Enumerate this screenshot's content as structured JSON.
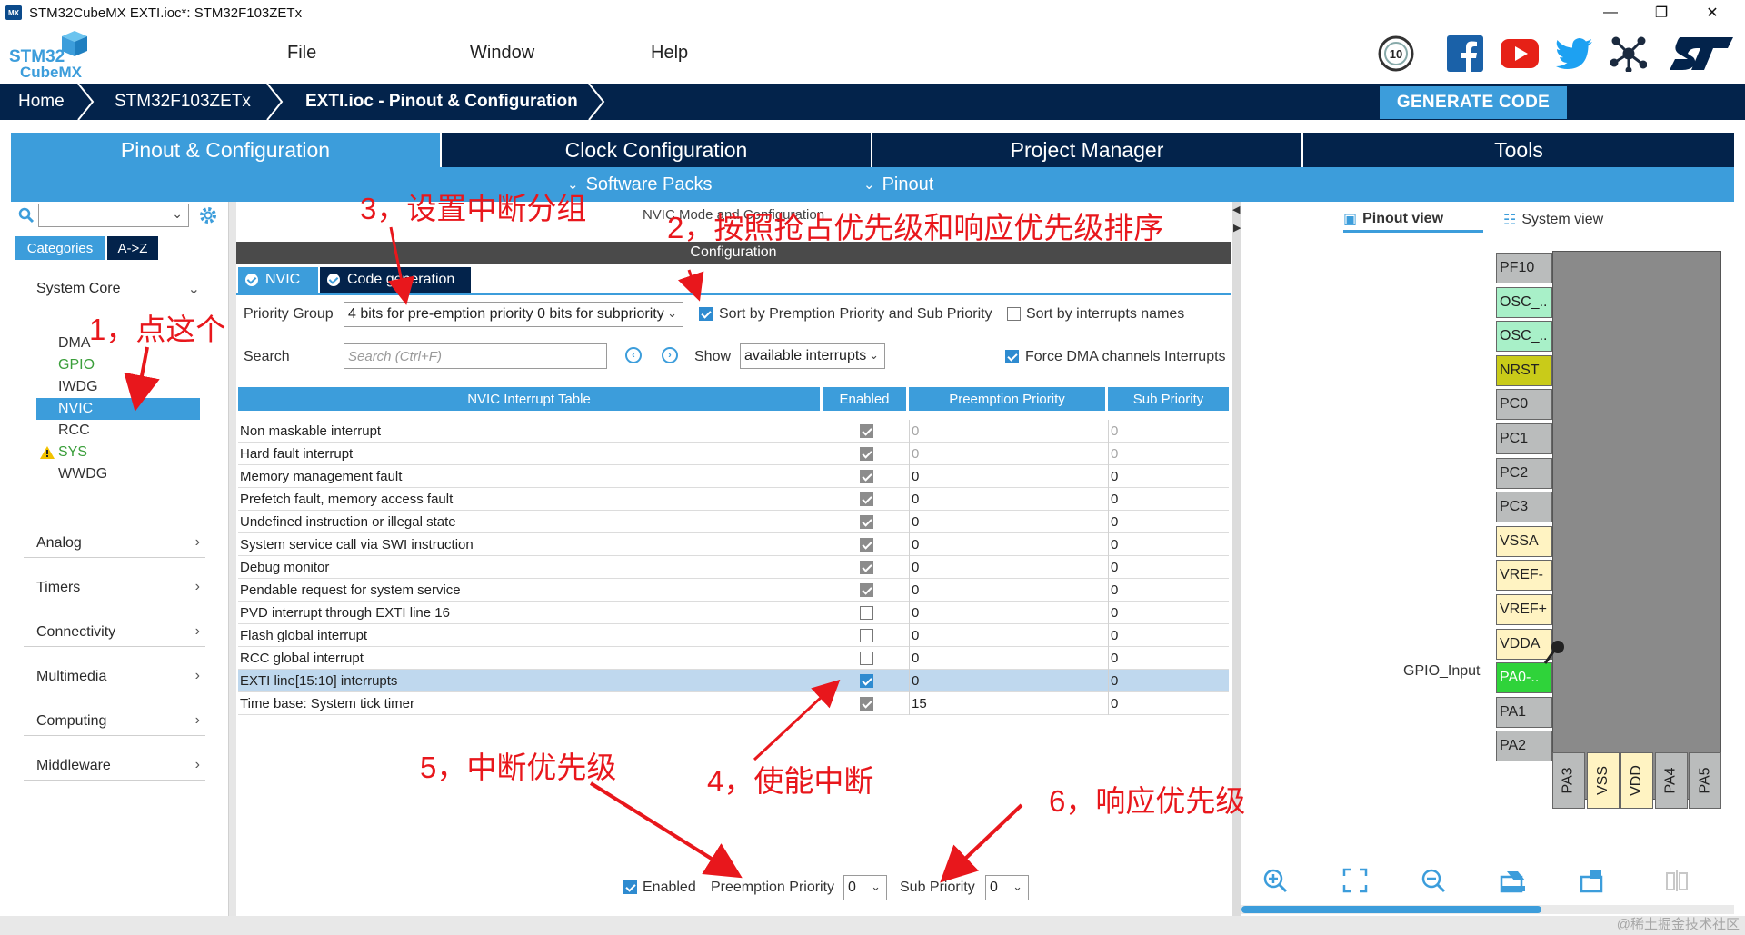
{
  "window": {
    "title": "STM32CubeMX EXTI.ioc*: STM32F103ZETx",
    "app_icon_label": "MX",
    "controls": {
      "minimize": "—",
      "maximize": "❐",
      "close": "✕"
    }
  },
  "menu": {
    "logo_top": "STM32",
    "logo_bottom": "CubeMX",
    "items": [
      "File",
      "Window",
      "Help"
    ],
    "social_icons": [
      "anniversary-10-icon",
      "facebook-icon",
      "youtube-icon",
      "twitter-icon",
      "network-icon",
      "st-logo-icon"
    ],
    "anniversary_label": "10"
  },
  "breadcrumb": {
    "items": [
      "Home",
      "STM32F103ZETx",
      "EXTI.ioc - Pinout & Configuration"
    ],
    "generate_label": "GENERATE CODE"
  },
  "main_tabs": [
    "Pinout & Configuration",
    "Clock Configuration",
    "Project Manager",
    "Tools"
  ],
  "sub_tabs": [
    "Software Packs",
    "Pinout"
  ],
  "sidebar": {
    "tab_categories": "Categories",
    "tab_az": "A->Z",
    "groups": {
      "system_core": "System Core",
      "analog": "Analog",
      "timers": "Timers",
      "connectivity": "Connectivity",
      "multimedia": "Multimedia",
      "computing": "Computing",
      "middleware": "Middleware"
    },
    "items": [
      "DMA",
      "GPIO",
      "IWDG",
      "NVIC",
      "RCC",
      "SYS",
      "WWDG"
    ]
  },
  "center": {
    "mode_title": "NVIC Mode and Configuration",
    "configuration_label": "Configuration",
    "inner_tabs": [
      "NVIC",
      "Code generation"
    ],
    "priority_group_label": "Priority Group",
    "priority_group_value": "4 bits for pre-emption priority 0 bits for subpriority",
    "sort_premption_label": "Sort by Premption Priority and Sub Priority",
    "sort_names_label": "Sort by interrupts names",
    "search_label": "Search",
    "search_placeholder": "Search (Ctrl+F)",
    "show_label": "Show",
    "show_value": "available interrupts",
    "force_dma_label": "Force DMA channels Interrupts",
    "table_headers": [
      "NVIC Interrupt Table",
      "Enabled",
      "Preemption Priority",
      "Sub Priority"
    ],
    "rows": [
      {
        "name": "Non maskable interrupt",
        "enabled": true,
        "locked": true,
        "pre": "0",
        "sub": "0",
        "dim": true
      },
      {
        "name": "Hard fault interrupt",
        "enabled": true,
        "locked": true,
        "pre": "0",
        "sub": "0",
        "dim": true
      },
      {
        "name": "Memory management fault",
        "enabled": true,
        "locked": true,
        "pre": "0",
        "sub": "0",
        "dim": false
      },
      {
        "name": "Prefetch fault, memory access fault",
        "enabled": true,
        "locked": true,
        "pre": "0",
        "sub": "0",
        "dim": false
      },
      {
        "name": "Undefined instruction or illegal state",
        "enabled": true,
        "locked": true,
        "pre": "0",
        "sub": "0",
        "dim": false
      },
      {
        "name": "System service call via SWI instruction",
        "enabled": true,
        "locked": true,
        "pre": "0",
        "sub": "0",
        "dim": false
      },
      {
        "name": "Debug monitor",
        "enabled": true,
        "locked": true,
        "pre": "0",
        "sub": "0",
        "dim": false
      },
      {
        "name": "Pendable request for system service",
        "enabled": true,
        "locked": true,
        "pre": "0",
        "sub": "0",
        "dim": false
      },
      {
        "name": "PVD interrupt through EXTI line 16",
        "enabled": false,
        "locked": false,
        "pre": "0",
        "sub": "0",
        "dim": false
      },
      {
        "name": "Flash global interrupt",
        "enabled": false,
        "locked": false,
        "pre": "0",
        "sub": "0",
        "dim": false
      },
      {
        "name": "RCC global interrupt",
        "enabled": false,
        "locked": false,
        "pre": "0",
        "sub": "0",
        "dim": false
      },
      {
        "name": "EXTI line[15:10] interrupts",
        "enabled": true,
        "locked": false,
        "pre": "0",
        "sub": "0",
        "dim": false,
        "selected": true
      },
      {
        "name": "Time base: System tick timer",
        "enabled": true,
        "locked": true,
        "pre": "15",
        "sub": "0",
        "dim": false
      }
    ],
    "bottom": {
      "enabled_label": "Enabled",
      "preemption_label": "Preemption Priority",
      "preemption_value": "0",
      "sub_label": "Sub Priority",
      "sub_value": "0"
    }
  },
  "right": {
    "pinout_view": "Pinout view",
    "system_view": "System view",
    "gpio_input_label": "GPIO_Input",
    "left_pins": [
      {
        "label": "PF10",
        "style": "grey"
      },
      {
        "label": "OSC_..",
        "style": "mint"
      },
      {
        "label": "OSC_..",
        "style": "mint"
      },
      {
        "label": "NRST",
        "style": "olive"
      },
      {
        "label": "PC0",
        "style": "grey"
      },
      {
        "label": "PC1",
        "style": "grey"
      },
      {
        "label": "PC2",
        "style": "grey"
      },
      {
        "label": "PC3",
        "style": "grey"
      },
      {
        "label": "VSSA",
        "style": "cream"
      },
      {
        "label": "VREF-",
        "style": "cream"
      },
      {
        "label": "VREF+",
        "style": "cream"
      },
      {
        "label": "VDDA",
        "style": "cream"
      },
      {
        "label": "PA0-..",
        "style": "green"
      },
      {
        "label": "PA1",
        "style": "grey"
      },
      {
        "label": "PA2",
        "style": "grey"
      }
    ],
    "bottom_pins": [
      {
        "label": "PA3",
        "style": "grey"
      },
      {
        "label": "VSS",
        "style": "cream"
      },
      {
        "label": "VDD",
        "style": "cream"
      },
      {
        "label": "PA4",
        "style": "grey"
      },
      {
        "label": "PA5",
        "style": "grey"
      }
    ]
  },
  "annotations": {
    "a1": "1，点这个",
    "a2": "2，按照抢占优先级和响应优先级排序",
    "a3": "3，设置中断分组",
    "a4": "4，使能中断",
    "a5": "5，中断优先级",
    "a6": "6，响应优先级"
  },
  "watermark": "@稀土掘金技术社区",
  "colors": {
    "navy": "#03234b",
    "accent": "#3c9ddb",
    "annotation": "#e8171c"
  }
}
